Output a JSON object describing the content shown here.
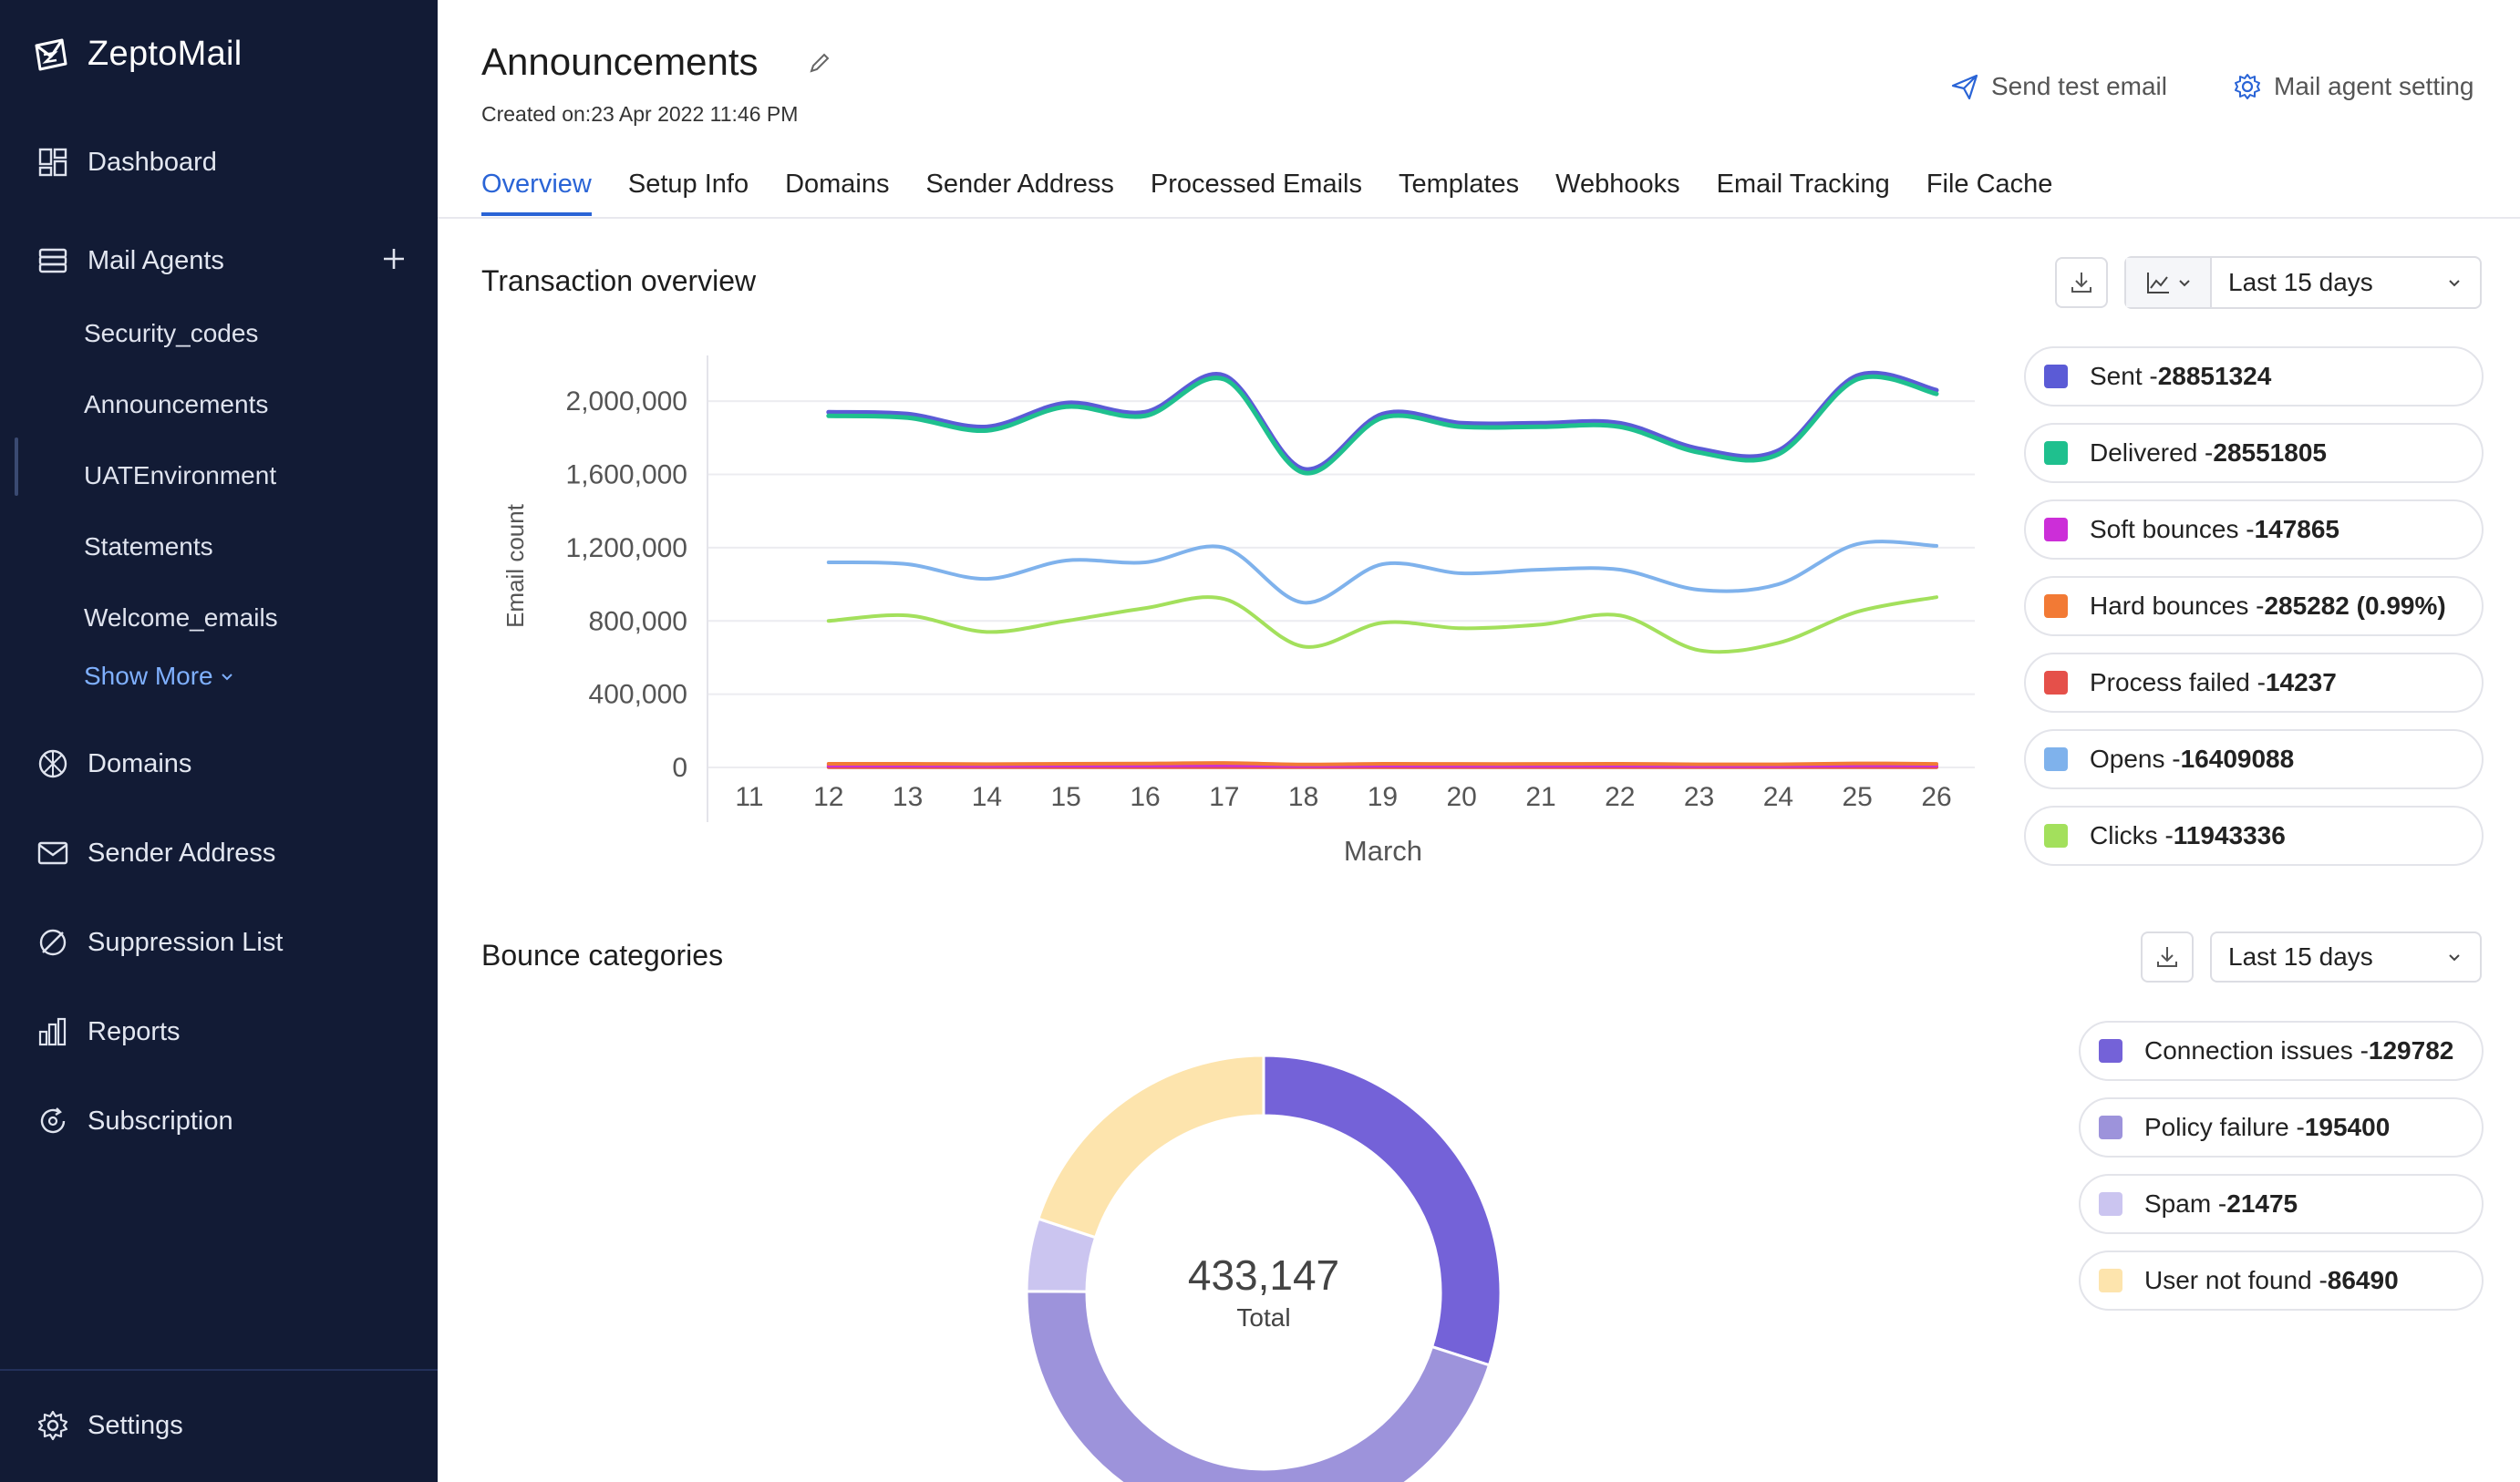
{
  "app": {
    "name": "ZeptoMail"
  },
  "sidebar": {
    "items": [
      {
        "label": "Dashboard",
        "icon": "dashboard-icon"
      },
      {
        "label": "Mail Agents",
        "icon": "mail-agents-icon"
      },
      {
        "label": "Domains",
        "icon": "globe-icon"
      },
      {
        "label": "Sender Address",
        "icon": "envelope-icon"
      },
      {
        "label": "Suppression List",
        "icon": "block-icon"
      },
      {
        "label": "Reports",
        "icon": "bar-chart-icon"
      },
      {
        "label": "Subscription",
        "icon": "subscription-icon"
      },
      {
        "label": "Settings",
        "icon": "gear-icon"
      }
    ],
    "mail_agents": [
      "Security_codes",
      "Announcements",
      "UATEnvironment",
      "Statements",
      "Welcome_emails"
    ],
    "show_more": "Show More"
  },
  "header": {
    "title": "Announcements",
    "created": "Created on:23 Apr 2022 11:46 PM",
    "send_test": "Send test email",
    "agent_setting": "Mail agent setting"
  },
  "tabs": [
    "Overview",
    "Setup Info",
    "Domains",
    "Sender Address",
    "Processed Emails",
    "Templates",
    "Webhooks",
    "Email Tracking",
    "File Cache"
  ],
  "transaction": {
    "title": "Transaction overview",
    "range": "Last 15 days",
    "legend": [
      {
        "label": "Sent - ",
        "value": "28851324",
        "color": "#5b5bd6"
      },
      {
        "label": "Delivered - ",
        "value": "28551805",
        "color": "#1fc08e"
      },
      {
        "label": "Soft bounces - ",
        "value": "147865",
        "color": "#cc2ed8"
      },
      {
        "label": "Hard bounces - ",
        "value": "285282 (0.99%)",
        "color": "#f27a35"
      },
      {
        "label": "Process failed - ",
        "value": "14237",
        "color": "#e5504a"
      },
      {
        "label": "Opens - ",
        "value": "16409088",
        "color": "#7fb2ec"
      },
      {
        "label": "Clicks - ",
        "value": "11943336",
        "color": "#a3e05c"
      }
    ]
  },
  "bounce": {
    "title": "Bounce categories",
    "range": "Last 15 days",
    "total": "433,147",
    "total_label": "Total",
    "legend": [
      {
        "label": "Connection issues - ",
        "value": "129782",
        "color": "#7462d8"
      },
      {
        "label": "Policy failure - ",
        "value": "195400",
        "color": "#9d93db"
      },
      {
        "label": "Spam - ",
        "value": "21475",
        "color": "#cbc5f0"
      },
      {
        "label": "User not found - ",
        "value": "86490",
        "color": "#fde4ad"
      }
    ]
  },
  "chart_data": [
    {
      "type": "line",
      "ylabel": "Email count",
      "xlabel": "March",
      "ylim": [
        0,
        2200000
      ],
      "yticks": [
        "0",
        "400,000",
        "800,000",
        "1,200,000",
        "1,600,000",
        "2,000,000"
      ],
      "x": [
        12,
        13,
        14,
        15,
        16,
        17,
        18,
        19,
        20,
        21,
        22,
        23,
        24,
        25,
        26
      ],
      "xticks": [
        "11",
        "12",
        "13",
        "14",
        "15",
        "16",
        "17",
        "18",
        "19",
        "20",
        "21",
        "22",
        "23",
        "24",
        "25",
        "26"
      ],
      "series": [
        {
          "name": "Sent",
          "color": "#5b5bd6",
          "values": [
            1940000,
            1930000,
            1860000,
            1990000,
            1940000,
            2140000,
            1630000,
            1930000,
            1880000,
            1880000,
            1880000,
            1740000,
            1730000,
            2140000,
            2060000
          ]
        },
        {
          "name": "Delivered",
          "color": "#1fc08e",
          "values": [
            1920000,
            1910000,
            1840000,
            1970000,
            1920000,
            2120000,
            1610000,
            1910000,
            1860000,
            1860000,
            1860000,
            1720000,
            1710000,
            2120000,
            2040000
          ]
        },
        {
          "name": "Opens",
          "color": "#7fb2ec",
          "values": [
            1120000,
            1110000,
            1030000,
            1130000,
            1120000,
            1200000,
            900000,
            1110000,
            1060000,
            1080000,
            1080000,
            970000,
            1000000,
            1220000,
            1210000
          ]
        },
        {
          "name": "Clicks",
          "color": "#a3e05c",
          "values": [
            800000,
            830000,
            740000,
            800000,
            870000,
            920000,
            660000,
            790000,
            760000,
            780000,
            830000,
            640000,
            680000,
            850000,
            930000
          ]
        },
        {
          "name": "Hard bounces",
          "color": "#f27a35",
          "values": [
            20000,
            20000,
            18000,
            20000,
            21000,
            24000,
            16000,
            20000,
            19000,
            19000,
            20000,
            17000,
            17000,
            22000,
            19000
          ]
        },
        {
          "name": "Soft bounces",
          "color": "#cc2ed8",
          "values": [
            10000,
            10000,
            9000,
            10000,
            10000,
            12000,
            8000,
            10000,
            9000,
            9000,
            10000,
            8000,
            8000,
            11000,
            10000
          ]
        },
        {
          "name": "Process failed",
          "color": "#e5504a",
          "values": [
            1000,
            1000,
            1000,
            1000,
            1000,
            1000,
            1000,
            1000,
            1000,
            1000,
            1000,
            1000,
            1000,
            1000,
            1000
          ]
        }
      ]
    },
    {
      "type": "pie",
      "categories": [
        "Connection issues",
        "Policy failure",
        "Spam",
        "User not found"
      ],
      "values": [
        129782,
        195400,
        21475,
        86490
      ],
      "colors": [
        "#7462d8",
        "#9d93db",
        "#cbc5f0",
        "#fde4ad"
      ]
    }
  ]
}
